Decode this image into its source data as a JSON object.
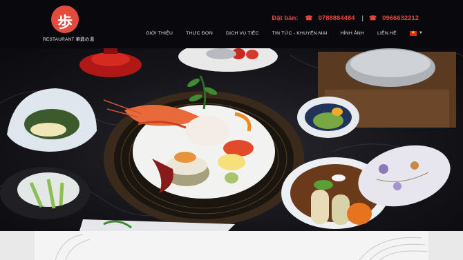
{
  "brand": {
    "logo_glyph": "歩",
    "logo_text": "RESTAURANT 華鼎の湯"
  },
  "booking": {
    "label": "Đặt bàn:",
    "phone_1": "0788884484",
    "separator": "|",
    "phone_2": "0966632212",
    "icon": "phone-icon"
  },
  "nav": {
    "items": [
      "GIỚI THIỆU",
      "THỰC ĐƠN",
      "DỊCH VỤ TIỆC",
      "TIN TỨC - KHUYẾN MẠI",
      "HÌNH ẢNH",
      "LIÊN HỆ"
    ],
    "language_icon": "vietnam-flag-icon"
  },
  "colors": {
    "accent": "#e8453a",
    "header_bg": "#08080d",
    "logo_red": "#e34b3c"
  }
}
